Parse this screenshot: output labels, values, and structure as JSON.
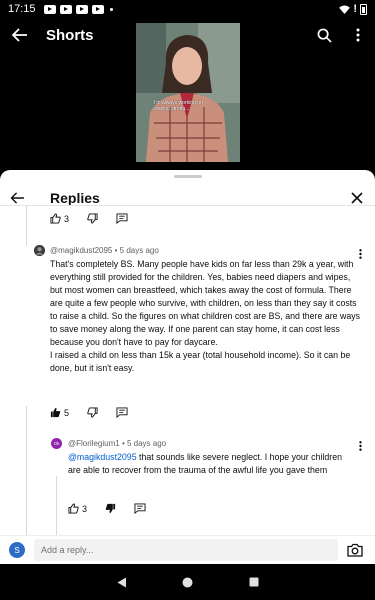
{
  "status_bar": {
    "time": "17:15",
    "alert": "!"
  },
  "header": {
    "title": "Shorts"
  },
  "video": {
    "caption": "I'm always working on staying strong..."
  },
  "replies": {
    "title": "Replies"
  },
  "top_actions": {
    "like_count": "3"
  },
  "comments": [
    {
      "author": "@magikdust2095",
      "age": "5 days ago",
      "paragraphs": [
        "That's completely BS. Many people have kids on far less than 29k a year, with everything still provided for the children. Yes, babies need diapers and wipes, but most women can breastfeed, which takes away the cost of formula. There are quite a few people who survive, with children, on less than they say it costs to raise a child. So the figures on what children cost are BS, and there are ways to save money along the way. If one parent can stay home, it can cost less because you don't have to pay for daycare.",
        "I raised a child on less than 15k a year (total household income). So it can be done, but it isn't easy."
      ],
      "like_count": "5",
      "liked": true
    },
    {
      "author": "@Florilegium1",
      "age": "5 days ago",
      "avatar_initials": "Ok",
      "avatar_color": "#8e24aa",
      "mention": "@magikdust2095",
      "text": " that sounds like severe neglect. I hope your children are able to recover from the trauma of the awful life you gave them",
      "like_count": "3",
      "disliked": true
    }
  ],
  "reply_bar": {
    "avatar_letter": "S",
    "placeholder": "Add a reply..."
  }
}
